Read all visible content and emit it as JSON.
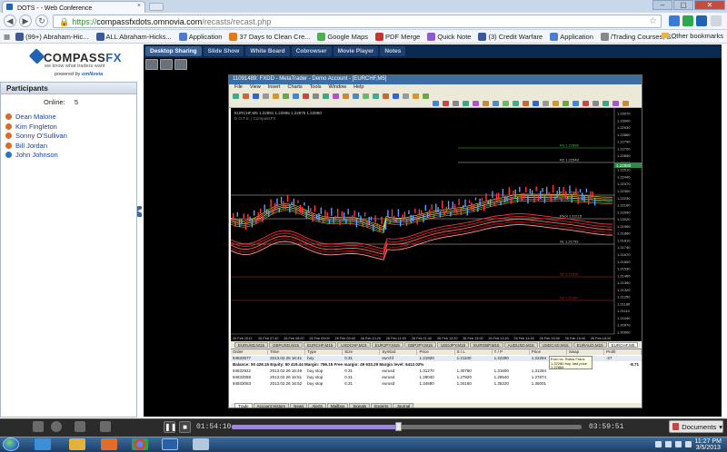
{
  "browser": {
    "tab_title": "DOTS - - Web Conference",
    "tab_close": "×",
    "url_scheme": "https://",
    "url_host": "compassfxdots.omnovia.com",
    "url_path": "/recasts/recast.php",
    "window_controls": [
      "–",
      "▢",
      "✕"
    ],
    "nav_back": "◀",
    "nav_forward": "▶",
    "reload": "↻",
    "star": "☆",
    "bookmarks": [
      {
        "label": "(99+) Abraham-Hic...",
        "color": "#3b5998"
      },
      {
        "label": "ALL Abraham-Hicks...",
        "color": "#3b5998"
      },
      {
        "label": "Application",
        "color": "#4d7bd1"
      },
      {
        "label": "37 Days to Clean Cre...",
        "color": "#d97c1f"
      },
      {
        "label": "Google Maps",
        "color": "#4caf50"
      },
      {
        "label": "PDF Merge",
        "color": "#c0392b"
      },
      {
        "label": "Quick Note",
        "color": "#8e5cc8"
      },
      {
        "label": "(3) Credit Warfare",
        "color": "#3b5998"
      },
      {
        "label": "Application",
        "color": "#4d7bd1"
      },
      {
        "label": "/Trading Courses; S...",
        "color": "#888888"
      }
    ],
    "other_bookmarks": "Other bookmarks"
  },
  "logo": {
    "brand_a": "COMPASS",
    "brand_b": "FX",
    "tagline": "we know what traders want",
    "powered_label": "powered by",
    "powered_brand": "omNovia"
  },
  "app_tabs": [
    "Desktop Sharing",
    "Slide Show",
    "White Board",
    "Cobrowser",
    "Movie Player",
    "Notes"
  ],
  "participants": {
    "title": "Participants",
    "online_label": "Online:",
    "online_count": "5",
    "list": [
      {
        "name": "Dean Malone",
        "color": "#d86b2b"
      },
      {
        "name": "Kim Fingleton",
        "color": "#d86b2b"
      },
      {
        "name": "Sonny O'Sullivan",
        "color": "#d86b2b"
      },
      {
        "name": "Bill Jordan",
        "color": "#d86b2b"
      },
      {
        "name": "John Johnson",
        "color": "#2a74c9"
      }
    ]
  },
  "metatrader": {
    "title": "11091489: FXDD - MetaTrader - Demo Account - [EURCHF,M5]",
    "menu": [
      "File",
      "View",
      "Insert",
      "Charts",
      "Tools",
      "Window",
      "Help"
    ],
    "chart_header": "EURCHF,M5 1.22891 1.22895 1.22876 1.22880",
    "indicator_label": "D.O.T.S. | CompassFX",
    "chart_tabs": [
      "EURUSD,M15",
      "GBPUSD,M15",
      "EURCHF,M15",
      "USDCHF,M15",
      "EURJPY,M15",
      "GBPJPY,M15",
      "USDJPY,M15",
      "EURGBP,M15",
      "AUDUSD,M15",
      "USDCAD,M15",
      "EURAUD,M15",
      "EURCHF,M5"
    ],
    "active_chart_tab": 11,
    "terminal_columns": [
      "Order",
      "Time",
      "Type",
      "Size",
      "Symbol",
      "Price",
      "S / L",
      "T / P",
      "Price",
      "Swap",
      "Profit"
    ],
    "orders": [
      [
        "94833577",
        "2013.02.26 16:41",
        "buy",
        "0.31",
        "eurchf",
        "1.21920",
        "1.21100",
        "1.22280",
        "1.22284",
        "0.00",
        "-27"
      ],
      [
        "94832922",
        "2013.02.26 16:49",
        "buy stop",
        "0.31",
        "eurusd",
        "1.31270",
        "1.30780",
        "1.31600",
        "1.31284",
        "",
        ""
      ],
      [
        "94833068",
        "2013.02.26 16:51",
        "buy stop",
        "0.31",
        "eurusd",
        "1.28040",
        "1.27820",
        "1.28540",
        "1.27874",
        "",
        ""
      ],
      [
        "94833063",
        "2013.02.26 16:52",
        "buy stop",
        "0.31",
        "eurusd",
        "1.34690",
        "1.34160",
        "1.35220",
        "1.35001",
        "",
        ""
      ]
    ],
    "balance_line": "Balance: 50 428.15 Equity: 50 419.44 Margin: 786.15 Free margin: 49 633.29 Margin level: 6412.02%",
    "balance_profit": "-8.71",
    "terminal_tabs": [
      "Trade",
      "Account History",
      "News",
      "Alerts",
      "Mailbox",
      "Signals",
      "Experts",
      "Journal"
    ],
    "tooltip": "Euro vs. Swiss Franc\n1.22280 buy, last price 1.22884",
    "y_ticks": [
      "1.23070",
      "1.23000",
      "1.22930",
      "1.22860",
      "1.22790",
      "1.22720",
      "1.22650",
      "1.22580",
      "1.22510",
      "1.22440",
      "1.22370",
      "1.22300",
      "1.22230",
      "1.22160",
      "1.22090",
      "1.22020",
      "1.21950",
      "1.21880",
      "1.21810",
      "1.21740",
      "1.21670",
      "1.21600",
      "1.21530",
      "1.21460",
      "1.21390",
      "1.21320",
      "1.21250",
      "1.21180",
      "1.21110",
      "1.21040",
      "1.20970",
      "1.20900"
    ],
    "x_ticks": [
      "26 Feb 2013",
      "26 Feb 07:40",
      "26 Feb 08:20",
      "26 Feb 09:00",
      "26 Feb 09:40",
      "26 Feb 10:20",
      "26 Feb 11:00",
      "26 Feb 11:40",
      "26 Feb 12:20",
      "26 Feb 13:00",
      "26 Feb 13:40",
      "26 Feb 14:20",
      "26 Feb 15:00",
      "26 Feb 15:40",
      "26 Feb 16:20"
    ],
    "level_labels": [
      "R3 1.22888",
      "R2 1.22548",
      "R1 1.22303",
      "Pivot 1.22115",
      "S1 1.21799",
      "S2 1.21535",
      "S3 1.21307"
    ],
    "price_tag": "1.22880"
  },
  "player": {
    "play_icon": "pause-icon",
    "stop_icon": "stop-icon",
    "current_time": "01:54:10",
    "total_time": "03:59:51",
    "progress_fraction": 0.476,
    "documents_label": "Documents"
  },
  "taskbar": {
    "time": "11:27 PM",
    "date": "3/5/2013"
  },
  "colors": {
    "accent": "#1f63b4",
    "nav": "#0b2a52",
    "chart_bg": "#000000"
  }
}
